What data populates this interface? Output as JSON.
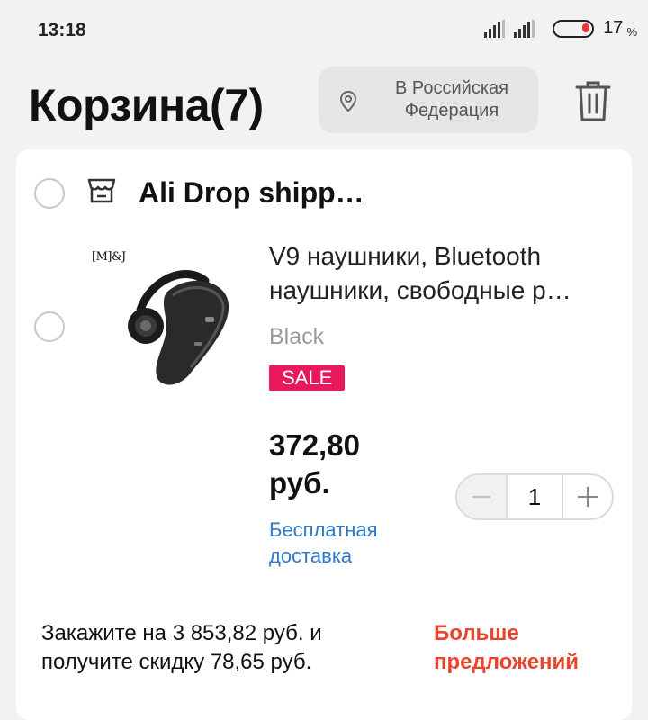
{
  "status_bar": {
    "time": "13:18",
    "battery_percent": "17",
    "battery_symbol": "%",
    "battery_color": "#e53935"
  },
  "header": {
    "title": "Корзина(7)",
    "location": "В Российская Федерация",
    "location_icon": "location-pin-icon",
    "delete_icon": "trash-icon"
  },
  "cart": {
    "store": {
      "name": "Ali Drop shipp…",
      "icon": "store-icon"
    },
    "items": [
      {
        "brand_mark": "[M]&J",
        "title": "V9 наушники, Bluetooth наушники, свободные р…",
        "variant": "Black",
        "badge": "SALE",
        "badge_color": "#e8185a",
        "price": "372,80 руб.",
        "shipping": "Бесплатная доставка",
        "quantity": "1"
      }
    ],
    "promo": {
      "text": "Закажите на 3 853,82 руб. и получите скидку 78,65 руб.",
      "link": "Больше предложений",
      "link_color": "#e8452c"
    }
  }
}
